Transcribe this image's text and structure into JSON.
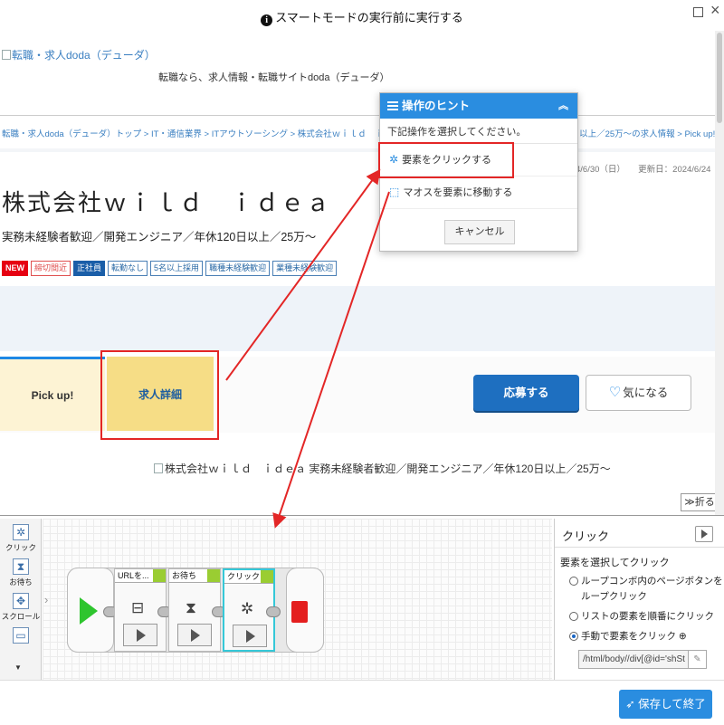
{
  "window": {
    "title": "スマートモードの実行前に実行する"
  },
  "page": {
    "logo_alt": "転職・求人doda（デューダ）",
    "tagline": "転職なら、求人情報・転職サイトdoda（デューダ）",
    "breadcrumb": "転職・求人doda（デューダ）トップ > IT・通信業界 > ITアウトソーシング > 株式会社ｗｉｌｄ　ｉｄｅａの",
    "breadcrumb_tail": "20日以上／25万〜の求人情報 > Pick up!",
    "dates": "4/6/30（日）　　更新日：2024/6/24（月",
    "company": "株式会社ｗｉｌｄ　ｉｄｅａ",
    "subtitle": "実務未経験者歓迎／開発エンジニア／年休120日以上／25万〜",
    "tags": [
      "NEW",
      "締切間近",
      "正社員",
      "転勤なし",
      "5名以上採用",
      "職種未経験歓迎",
      "業種未経験歓迎"
    ],
    "tab_pickup": "Pick up!",
    "tab_detail": "求人詳細",
    "apply": "応募する",
    "favorite": "気になる",
    "image_alt": "株式会社ｗｉｌｄ　ｉｄｅａ 実務未経験者歓迎／開発エンジニア／年休120日以上／25万〜",
    "collapse": "折る"
  },
  "hint": {
    "title": "操作のヒント",
    "desc": "下記操作を選択してください。",
    "click_element": "要素をクリックする",
    "hover_element": "マオスを要素に移動する",
    "cancel": "キャンセル"
  },
  "toolbox": {
    "click": "クリック",
    "wait": "お待ち",
    "scroll": "スクロール"
  },
  "flow": {
    "block_url": "URLを...",
    "block_wait": "お待ち",
    "block_click": "クリック"
  },
  "props": {
    "title": "クリック",
    "section": "要素を選択してクリック",
    "opt1": "ループコンボ内のページボタンをループクリック",
    "opt2": "リストの要素を順番にクリック",
    "opt3": "手動で要素をクリック",
    "xpath": "/html/body//div[@id='shSt"
  },
  "footer": {
    "save": "保存して終了"
  },
  "colors": {
    "accent": "#2a8de0",
    "highlight": "#e32626",
    "apply": "#1e6fc0"
  }
}
